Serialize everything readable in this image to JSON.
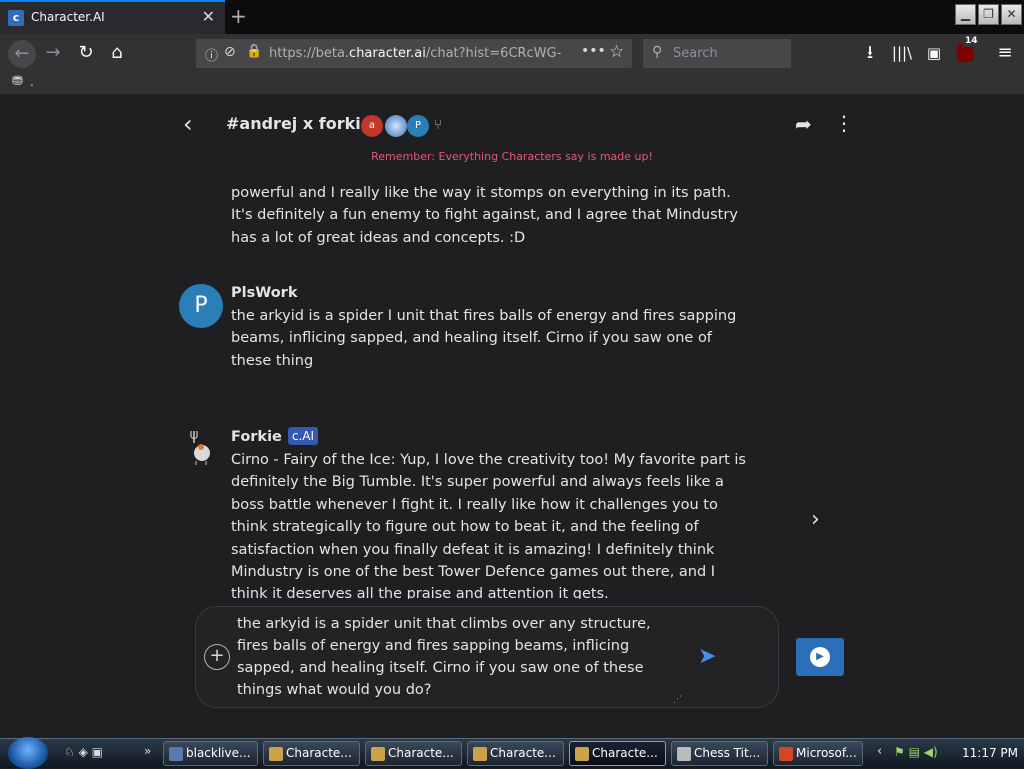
{
  "browser": {
    "tab_title": "Character.AI",
    "new_tab_glyph": "+",
    "url_prefix": "https://beta.",
    "url_domain": "character.ai",
    "url_suffix": "/chat?hist=6CRcWG-",
    "search_placeholder": "Search",
    "badge_count": "14",
    "bookmark_label": "."
  },
  "chat": {
    "title": "#andrej x forkies",
    "participants": [
      "a",
      "",
      "P",
      ""
    ],
    "reminder": "Remember: Everything Characters say is made up!"
  },
  "messages": {
    "partial_text": "powerful and I really like the way it stomps on everything in its path. It's definitely a fun enemy to fight against, and I agree that Mindustry has a lot of great ideas and concepts. :D",
    "plswork": {
      "avatar_letter": "P",
      "sender": "PlsWork",
      "text": "the arkyid is a spider I unit that fires balls of energy and fires sapping beams, inflicing sapped, and healing itself. Cirno if you saw one of these thing"
    },
    "forkie": {
      "sender": "Forkie",
      "badge": "c.AI",
      "text": "Cirno - Fairy of the Ice: Yup, I love the creativity too! My favorite part is definitely the Big Tumble. It's super powerful and always feels like a boss battle whenever I fight it. I really like how it challenges you to think strategically to figure out how to beat it, and the feeling of satisfaction when you finally defeat it is amazing! I definitely think Mindustry is one of the best Tower Defence games out there, and I think it deserves all the praise and attention it gets."
    }
  },
  "composer": {
    "text": "the arkyid is a spider unit that climbs over any structure, fires balls of energy and fires sapping beams, inflicing sapped, and healing itself. Cirno if you saw one of these things what would you do?"
  },
  "taskbar": {
    "items": [
      "blacklive...",
      "Characte...",
      "Characte...",
      "Characte...",
      "Characte...",
      "Chess Tit...",
      "Microsof..."
    ],
    "clock": "11:17 PM"
  },
  "colors": {
    "accent": "#0a84ff",
    "reminder": "#e05a78",
    "cai_badge": "#3658b0",
    "avatar_p": "#2b7fb8"
  }
}
